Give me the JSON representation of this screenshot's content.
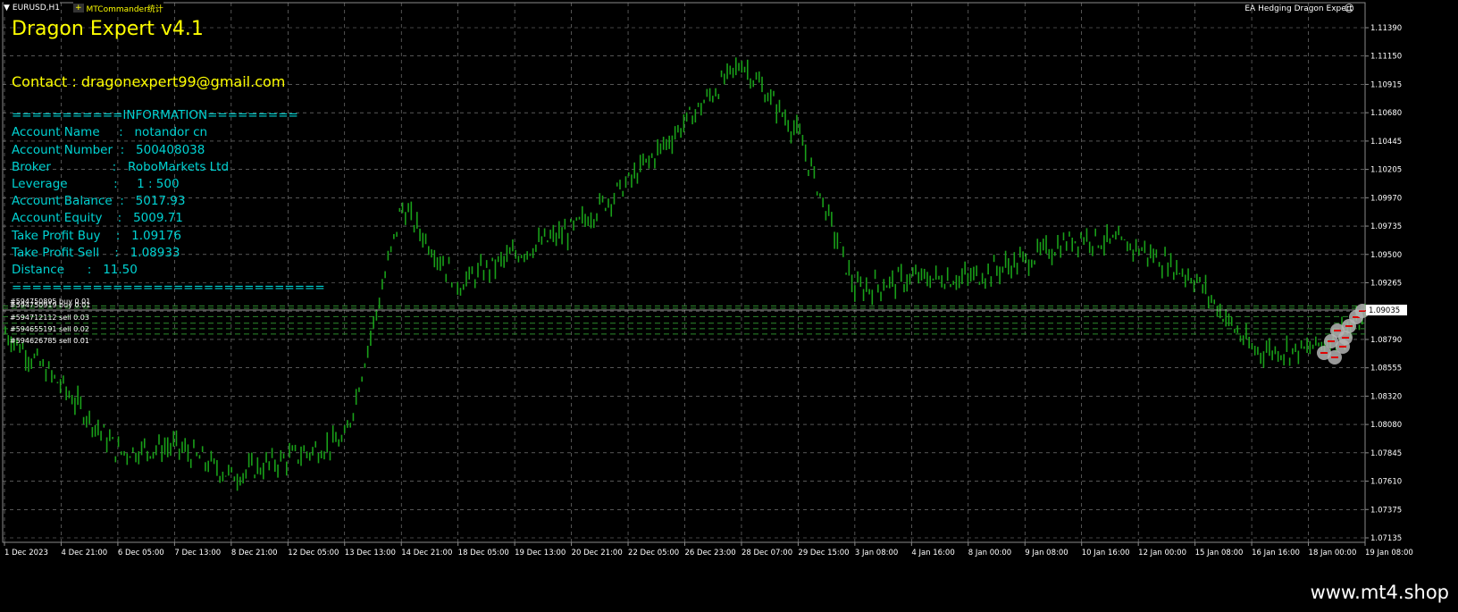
{
  "tabs": [
    {
      "label": "EURUSD,H1",
      "icon": "triangle-down-icon"
    },
    {
      "label": "MTCommander统计",
      "icon": "plus-icon"
    }
  ],
  "ea_label": "EA Hedging Dragon Expert",
  "overlay": {
    "title": "Dragon Expert v4.1",
    "contact": "Contact : dragonexpert99@gmail.com",
    "info_header": "===========INFORMATION=========",
    "info_lines": [
      "Account Name     :   notandor cn",
      "Account Number  :   500408038",
      "Broker                :   RoboMarkets Ltd",
      "Leverage            :     1 : 500",
      "Account Balance  :   5017.93",
      "Account Equity    :   5009.71",
      "Take Profit Buy    :   1.09176",
      "Take Profit Sell    :   1.08933",
      "Distance      :   11.50"
    ],
    "info_footer": "==============================="
  },
  "order_lines": [
    "#594750895 buy 0.01",
    "#594750919 buy 0.01",
    "#594712112 sell 0.03",
    "#594655191 sell 0.02",
    "#594626785 sell 0.01"
  ],
  "price_axis": [
    "1.11390",
    "1.11150",
    "1.10915",
    "1.10680",
    "1.10445",
    "1.10205",
    "1.09970",
    "1.09735",
    "1.09500",
    "1.09265",
    "1.09035",
    "1.08790",
    "1.08555",
    "1.08320",
    "1.08080",
    "1.07845",
    "1.07610",
    "1.07375",
    "1.07135"
  ],
  "current_price": "1.09035",
  "time_axis": [
    "1 Dec 2023",
    "4 Dec 21:00",
    "6 Dec 05:00",
    "7 Dec 13:00",
    "8 Dec 21:00",
    "12 Dec 05:00",
    "13 Dec 13:00",
    "14 Dec 21:00",
    "18 Dec 05:00",
    "19 Dec 13:00",
    "20 Dec 21:00",
    "22 Dec 05:00",
    "26 Dec 23:00",
    "28 Dec 07:00",
    "29 Dec 15:00",
    "3 Jan 08:00",
    "4 Jan 16:00",
    "8 Jan 00:00",
    "9 Jan 08:00",
    "10 Jan 16:00",
    "12 Jan 00:00",
    "15 Jan 08:00",
    "16 Jan 16:00",
    "18 Jan 00:00",
    "19 Jan 08:00"
  ],
  "watermark": "www.mt4.shop",
  "colors": {
    "background": "#000000",
    "candles": "#19a019",
    "grid": "#8a8a8a",
    "overlay_title": "#ffff00",
    "info_text": "#00d2d2",
    "order_level": "#2e8b2e"
  },
  "chart_data": {
    "type": "line",
    "symbol": "EURUSD,H1",
    "x": [
      "1 Dec 2023",
      "4 Dec 21:00",
      "6 Dec 05:00",
      "7 Dec 13:00",
      "8 Dec 21:00",
      "12 Dec 05:00",
      "13 Dec 13:00",
      "14 Dec 21:00",
      "18 Dec 05:00",
      "19 Dec 13:00",
      "20 Dec 21:00",
      "22 Dec 05:00",
      "26 Dec 23:00",
      "28 Dec 07:00",
      "29 Dec 15:00",
      "3 Jan 08:00",
      "4 Jan 16:00",
      "8 Jan 00:00",
      "9 Jan 08:00",
      "10 Jan 16:00",
      "12 Jan 00:00",
      "15 Jan 08:00",
      "16 Jan 16:00",
      "18 Jan 00:00",
      "19 Jan 08:00"
    ],
    "y": [
      1.0885,
      1.084,
      1.0785,
      1.079,
      1.0765,
      1.078,
      1.0795,
      1.099,
      1.0925,
      1.095,
      1.097,
      1.101,
      1.106,
      1.111,
      1.105,
      1.092,
      1.093,
      1.093,
      1.0945,
      1.0965,
      1.0955,
      1.093,
      1.087,
      1.087,
      1.0895
    ],
    "ylim": [
      1.07135,
      1.1139
    ],
    "current_price": 1.09035,
    "grid": true
  }
}
